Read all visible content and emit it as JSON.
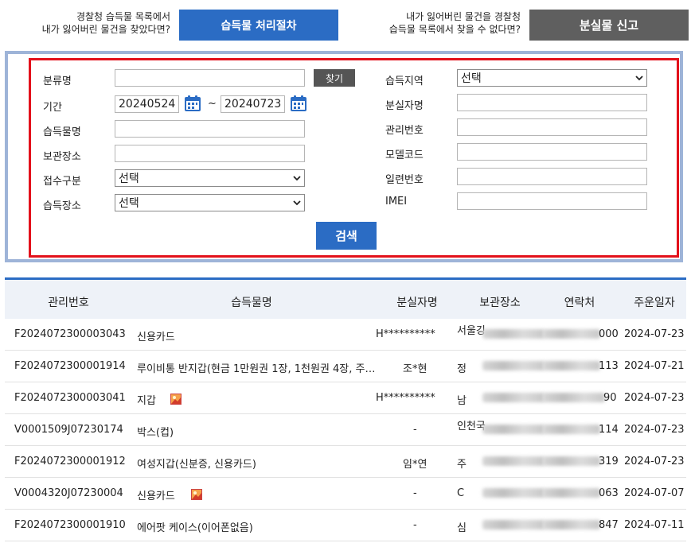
{
  "top": {
    "left_hint_line1": "경찰청 습득물 목록에서",
    "left_hint_line2": "내가 잃어버린 물건을 찾았다면?",
    "left_button": "습득물 처리절차",
    "right_hint_line1": "내가 잃어버린 물건을 경찰청",
    "right_hint_line2": "습득물 목록에서 찾을 수 없다면?",
    "right_button": "분실물 신고"
  },
  "form": {
    "category_label": "분류명",
    "category_value": "",
    "find_button": "찾기",
    "period_label": "기간",
    "date_from": "20240524",
    "date_tilde": "~",
    "date_to": "20240723",
    "item_name_label": "습득물명",
    "storage_label": "보관장소",
    "reception_label": "접수구분",
    "reception_value": "선택",
    "pickup_place_label": "습득장소",
    "pickup_place_value": "선택",
    "region_label": "습득지역",
    "region_value": "선택",
    "loser_label": "분실자명",
    "mgmt_no_label": "관리번호",
    "model_label": "모델코드",
    "serial_label": "일련번호",
    "imei_label": "IMEI",
    "search_button": "검색"
  },
  "table": {
    "headers": [
      "관리번호",
      "습득물명",
      "분실자명",
      "보관장소",
      "연락처",
      "주운일자"
    ],
    "rows": [
      {
        "id": "F2024072300003043",
        "name": "신용카드",
        "loser": "H**********",
        "storage": "서울깅",
        "phone": "000",
        "date": "2024-07-23",
        "img": false
      },
      {
        "id": "F2024072300001914",
        "name": "루이비통 반지갑(현금 1만원권 1장, 1천원권 4장, 주…",
        "loser": "조*현",
        "storage": "정",
        "phone": "113",
        "date": "2024-07-21",
        "img": false
      },
      {
        "id": "F2024072300003041",
        "name": "지갑",
        "loser": "H**********",
        "storage": "남",
        "phone": "90",
        "date": "2024-07-23",
        "img": true
      },
      {
        "id": "V0001509J07230174",
        "name": "박스(컵)",
        "loser": "-",
        "storage": "인천국",
        "phone": "114",
        "date": "2024-07-23",
        "img": false
      },
      {
        "id": "F2024072300001912",
        "name": "여성지갑(신분증, 신용카드)",
        "loser": "임*연",
        "storage": "주",
        "phone": "319",
        "date": "2024-07-23",
        "img": false
      },
      {
        "id": "V0004320J07230004",
        "name": "신용카드",
        "loser": "-",
        "storage": "C",
        "phone": "063",
        "date": "2024-07-07",
        "img": true
      },
      {
        "id": "F2024072300001910",
        "name": "에어팟 케이스(이어폰없음)",
        "loser": "-",
        "storage": "심",
        "phone": "847",
        "date": "2024-07-11",
        "img": false
      }
    ]
  },
  "colors": {
    "accent": "#2b6cc4",
    "red_border": "#e3111b",
    "outer_border": "#9eb4d8",
    "gray_button": "#5f5f5f"
  }
}
